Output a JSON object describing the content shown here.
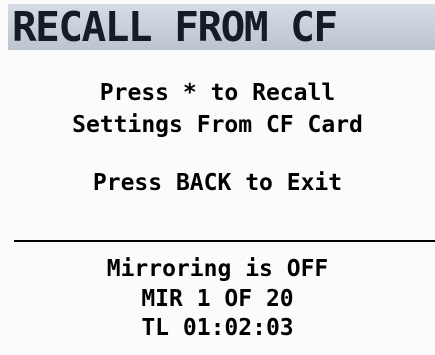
{
  "header": {
    "title": "RECALL FROM CF"
  },
  "prompt": {
    "line1": "Press * to Recall",
    "line2": "Settings From CF Card",
    "exit": "Press BACK to Exit"
  },
  "status": {
    "mirroring": "Mirroring is OFF",
    "mir": "MIR 1 OF 20",
    "timecode": "TL 01:02:03"
  },
  "colors": {
    "header_background": "#c9d0da",
    "header_text": "#151c27",
    "screen_background": "#fbfbfb",
    "text": "#000000"
  }
}
